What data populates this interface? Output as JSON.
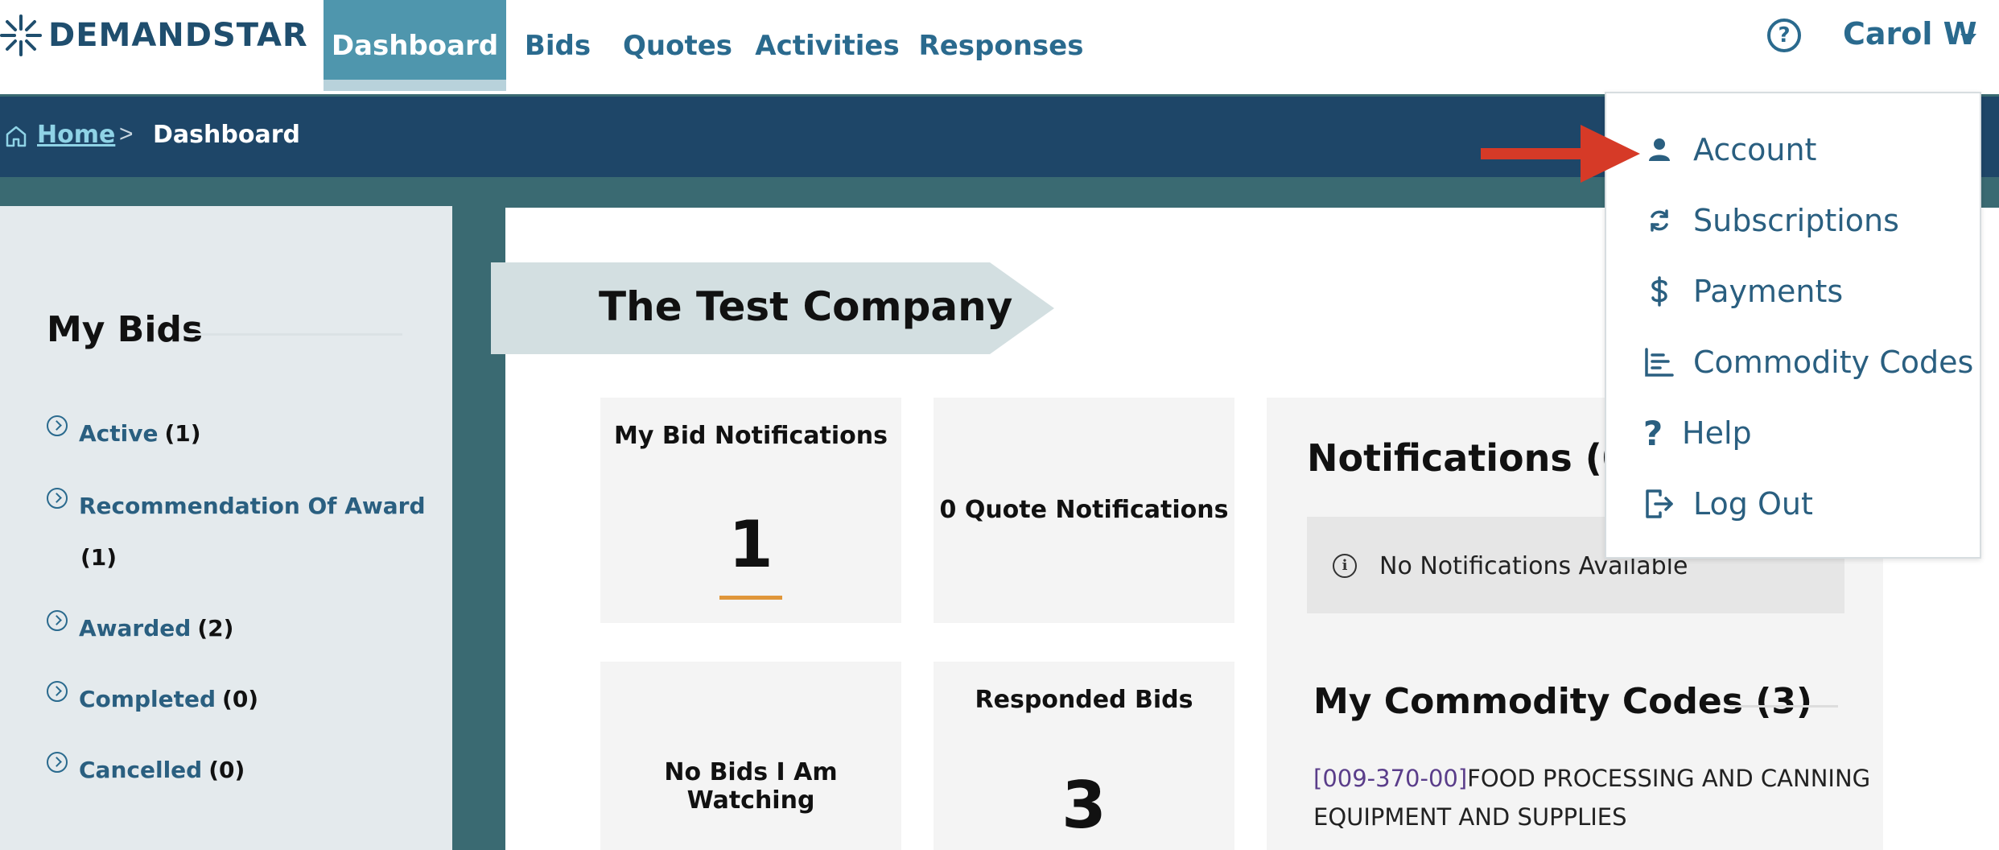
{
  "brand": {
    "name": "DEMANDSTAR"
  },
  "nav": {
    "tabs": [
      {
        "label": "Dashboard",
        "active": true
      },
      {
        "label": "Bids"
      },
      {
        "label": "Quotes"
      },
      {
        "label": "Activities"
      },
      {
        "label": "Responses"
      }
    ],
    "help_glyph": "?",
    "user_name": "Carol W"
  },
  "breadcrumb": {
    "home": "Home",
    "separator": ">",
    "current": "Dashboard"
  },
  "left_panel": {
    "title": "My Bids",
    "items": [
      {
        "label": "Active",
        "count": "(1)"
      },
      {
        "label": "Recommendation Of Award",
        "count": "(1)"
      },
      {
        "label": "Awarded",
        "count": "(2)"
      },
      {
        "label": "Completed",
        "count": "(0)"
      },
      {
        "label": "Cancelled",
        "count": "(0)"
      }
    ]
  },
  "main": {
    "company_name": "The Test Company",
    "cards": {
      "bid_notifications": {
        "title": "My Bid Notifications",
        "value": "1"
      },
      "quote_notifications": {
        "title": "0 Quote Notifications"
      },
      "watching": {
        "title": "No Bids I Am Watching"
      },
      "responded": {
        "title": "Responded Bids",
        "value": "3"
      }
    },
    "notifications": {
      "title": "Notifications (0)",
      "empty_text": "No Notifications Available",
      "info_glyph": "i"
    },
    "commodity_codes": {
      "title": "My Commodity Codes (3)",
      "first": {
        "code": "[009-370-00]",
        "text_line1": "FOOD PROCESSING AND CANNING",
        "text_line2": "EQUIPMENT AND SUPPLIES"
      }
    }
  },
  "user_menu": {
    "items": [
      {
        "label": "Account",
        "icon": "person-icon"
      },
      {
        "label": "Subscriptions",
        "icon": "refresh-icon"
      },
      {
        "label": "Payments",
        "icon": "dollar-icon"
      },
      {
        "label": "Commodity Codes",
        "icon": "list-chart-icon"
      },
      {
        "label": "Help",
        "icon": "question-icon"
      },
      {
        "label": "Log Out",
        "icon": "logout-icon"
      }
    ]
  },
  "colors": {
    "accent": "#4f96ad",
    "navy": "#1e4668",
    "link": "#2a5f80",
    "annotation_arrow": "#d63a27",
    "highlight": "#e0963a"
  }
}
